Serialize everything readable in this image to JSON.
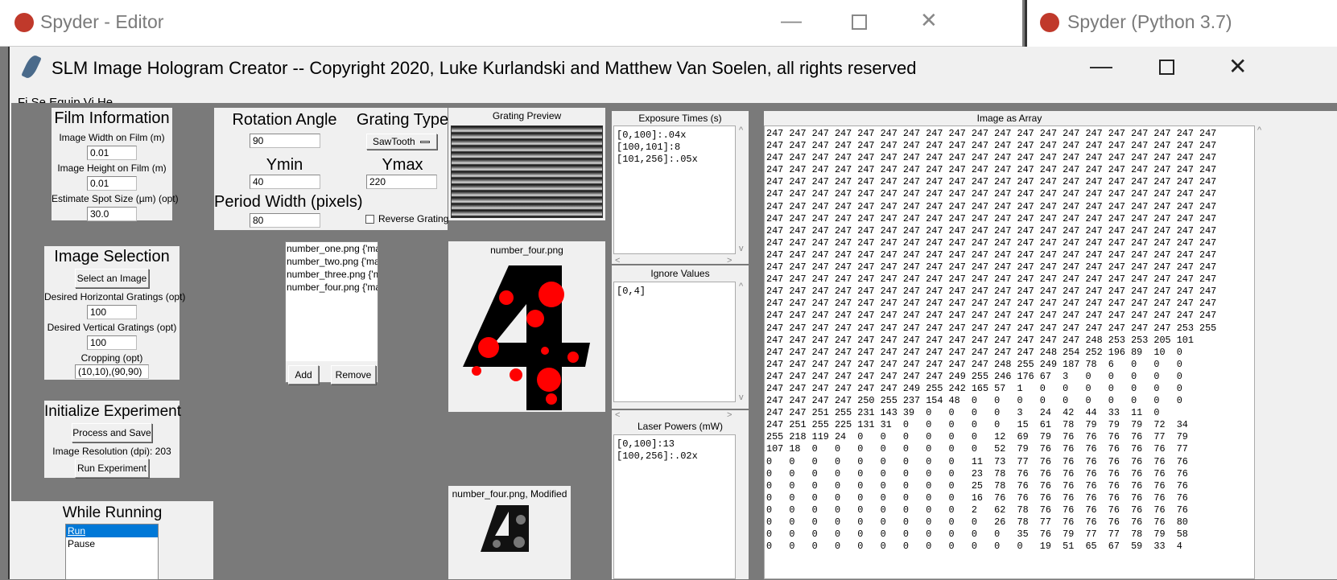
{
  "background_windows": {
    "editor_title": "Spyder - Editor",
    "python_title": "Spyder (Python 3.7)"
  },
  "window": {
    "title": "SLM Image Hologram Creator -- Copyright 2020, Luke Kurlandski and Matthew Van Soelen, all rights reserved",
    "menu_partial": "Fi  Se  Equip  Vi  He"
  },
  "film_info": {
    "title": "Film Information",
    "width_label": "Image Width on Film (m)",
    "width_value": "0.01",
    "height_label": "Image Height on Film (m)",
    "height_value": "0.01",
    "spot_label": "Estimate Spot Size (µm) (opt)",
    "spot_value": "30.0"
  },
  "image_selection": {
    "title": "Image Selection",
    "select_button": "Select an Image",
    "horiz_label": "Desired Horizontal Gratings (opt)",
    "horiz_value": "100",
    "vert_label": "Desired Vertical Gratings (opt)",
    "vert_value": "100",
    "crop_label": "Cropping (opt)",
    "crop_value": "(10,10),(90,90)"
  },
  "init_experiment": {
    "title": "Initialize Experiment",
    "process_button": "Process and Save",
    "resolution_text": "Image Resolution (dpi): 203",
    "run_button": "Run Experiment"
  },
  "while_running": {
    "title": "While Running",
    "options": [
      "Run",
      "Pause"
    ],
    "selected": "Run"
  },
  "grating": {
    "rotation_label": "Rotation Angle",
    "rotation_value": "90",
    "type_label": "Grating Type",
    "type_value": "SawTooth",
    "ymin_label": "Ymin",
    "ymin_value": "40",
    "ymax_label": "Ymax",
    "ymax_value": "220",
    "period_label": "Period Width (pixels)",
    "period_value": "80",
    "reverse_label": "Reverse Grating",
    "reverse_checked": false
  },
  "grating_preview": {
    "title": "Grating Preview"
  },
  "image_list": {
    "items": [
      "number_one.png {'ma:",
      "number_two.png {'ma:",
      "number_three.png {'m",
      "number_four.png {'ma"
    ],
    "add_button": "Add",
    "remove_button": "Remove"
  },
  "image_preview": {
    "title": "number_four.png",
    "modified_title": "number_four.png, Modified",
    "glyph": "4",
    "glyph_color": "#000000",
    "dot_color": "#ff0000"
  },
  "exposure_times": {
    "title": "Exposure Times (s)",
    "lines": [
      "[0,100]:.04x",
      "[100,101]:8",
      "[101,256]:.05x"
    ]
  },
  "ignore_values": {
    "title": "Ignore Values",
    "lines": [
      "[0,4]"
    ]
  },
  "laser_powers": {
    "title": "Laser Powers (mW)",
    "lines": [
      "[0,100]:13",
      "[100,256]:.02x"
    ]
  },
  "image_array": {
    "title": "Image as Array",
    "rows": [
      "247 247 247 247 247 247 247 247 247 247 247 247 247 247 247 247 247 247 247 247",
      "247 247 247 247 247 247 247 247 247 247 247 247 247 247 247 247 247 247 247 247",
      "247 247 247 247 247 247 247 247 247 247 247 247 247 247 247 247 247 247 247 247",
      "247 247 247 247 247 247 247 247 247 247 247 247 247 247 247 247 247 247 247 247",
      "247 247 247 247 247 247 247 247 247 247 247 247 247 247 247 247 247 247 247 247",
      "247 247 247 247 247 247 247 247 247 247 247 247 247 247 247 247 247 247 247 247",
      "247 247 247 247 247 247 247 247 247 247 247 247 247 247 247 247 247 247 247 247",
      "247 247 247 247 247 247 247 247 247 247 247 247 247 247 247 247 247 247 247 247",
      "247 247 247 247 247 247 247 247 247 247 247 247 247 247 247 247 247 247 247 247",
      "247 247 247 247 247 247 247 247 247 247 247 247 247 247 247 247 247 247 247 247",
      "247 247 247 247 247 247 247 247 247 247 247 247 247 247 247 247 247 247 247 247",
      "247 247 247 247 247 247 247 247 247 247 247 247 247 247 247 247 247 247 247 247",
      "247 247 247 247 247 247 247 247 247 247 247 247 247 247 247 247 247 247 247 247",
      "247 247 247 247 247 247 247 247 247 247 247 247 247 247 247 247 247 247 247 247",
      "247 247 247 247 247 247 247 247 247 247 247 247 247 247 247 247 247 247 247 247",
      "247 247 247 247 247 247 247 247 247 247 247 247 247 247 247 247 247 247 247 247",
      "247 247 247 247 247 247 247 247 247 247 247 247 247 247 247 247 247 247 253 255",
      "247 247 247 247 247 247 247 247 247 247 247 247 247 247 248 253 253 205 101",
      "247 247 247 247 247 247 247 247 247 247 247 247 248 254 252 196 89  10  0",
      "247 247 247 247 247 247 247 247 247 247 248 255 249 187 78  6   0   0   0",
      "247 247 247 247 247 247 247 247 249 255 246 176 67  3   0   0   0   0   0",
      "247 247 247 247 247 247 249 255 242 165 57  1   0   0   0   0   0   0   0",
      "247 247 247 247 250 255 237 154 48  0   0   0   0   0   0   0   0   0   0",
      "247 247 251 255 231 143 39  0   0   0   0   3   24  42  44  33  11  0",
      "247 251 255 225 131 31  0   0   0   0   0   15  61  78  79  79  79  72  34",
      "255 218 119 24  0   0   0   0   0   0   12  69  79  76  76  76  76  77  79",
      "107 18  0   0   0   0   0   0   0   0   52  79  76  76  76  76  76  76  77",
      "0   0   0   0   0   0   0   0   0   11  73  77  76  76  76  76  76  76  76",
      "0   0   0   0   0   0   0   0   0   23  78  76  76  76  76  76  76  76  76",
      "0   0   0   0   0   0   0   0   0   25  78  76  76  76  76  76  76  76  76",
      "0   0   0   0   0   0   0   0   0   16  76  76  76  76  76  76  76  76  76",
      "0   0   0   0   0   0   0   0   0   2   62  78  76  76  76  76  76  76  76",
      "0   0   0   0   0   0   0   0   0   0   26  78  77  76  76  76  76  76  80",
      "0   0   0   0   0   0   0   0   0   0   0   35  76  79  77  77  78  79  58",
      "0   0   0   0   0   0   0   0   0   0   0   0   19  51  65  67  59  33  4"
    ]
  }
}
